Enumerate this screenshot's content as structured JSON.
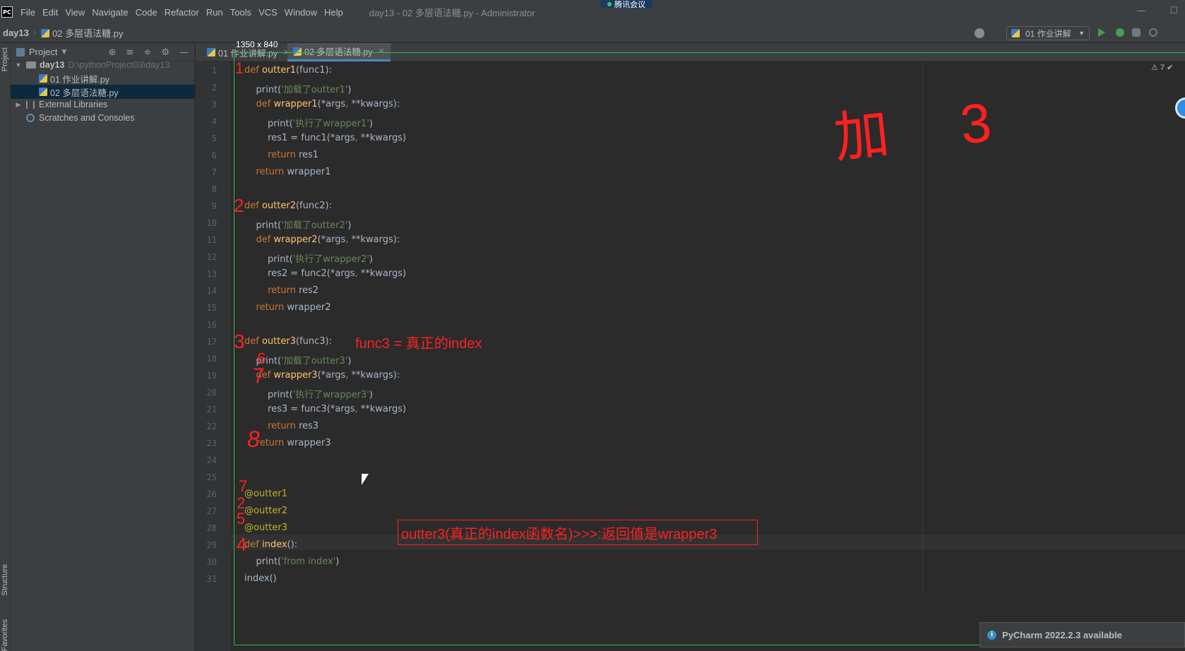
{
  "titlebar": {
    "menu": [
      "File",
      "Edit",
      "View",
      "Navigate",
      "Code",
      "Refactor",
      "Run",
      "Tools",
      "VCS",
      "Window",
      "Help"
    ],
    "window_title": "day13 - 02 多层语法糖.py - Administrator",
    "meeting_label": "腾讯会议"
  },
  "navbar": {
    "project": "day13",
    "file": "02 多层语法糖.py",
    "run_config": "01 作业讲解"
  },
  "left_strip": {
    "project_tab": "Project",
    "structure_tab": "Structure",
    "favorites_tab": "Favorites"
  },
  "project_panel": {
    "title": "Project",
    "tree": {
      "root_label": "day13",
      "root_path": "D:\\pythonProject03\\day13",
      "file1": "01 作业讲解.py",
      "file2": "02 多层语法糖.py",
      "external_libraries": "External Libraries",
      "scratches": "Scratches and Consoles"
    }
  },
  "editor": {
    "tabs": [
      "01 作业讲解.py",
      "02 多层语法糖.py"
    ],
    "warning_count": "7",
    "capture_size": "1350 x 840"
  },
  "code_lines": [
    "def outter1(func1):",
    "    print('加载了outter1')",
    "    def wrapper1(*args, **kwargs):",
    "        print('执行了wrapper1')",
    "        res1 = func1(*args, **kwargs)",
    "        return res1",
    "    return wrapper1",
    "",
    "def outter2(func2):",
    "    print('加载了outter2')",
    "    def wrapper2(*args, **kwargs):",
    "        print('执行了wrapper2')",
    "        res2 = func2(*args, **kwargs)",
    "        return res2",
    "    return wrapper2",
    "",
    "def outter3(func3):",
    "    print('加载了outter3')",
    "    def wrapper3(*args, **kwargs):",
    "        print('执行了wrapper3')",
    "        res3 = func3(*args, **kwargs)",
    "        return res3",
    "    return wrapper3",
    "",
    "",
    "@outter1",
    "@outter2",
    "@outter3",
    "def index():",
    "    print('from index')",
    "index()"
  ],
  "annotations": {
    "handwritten_top": "加 3",
    "func3_note": "func3 = 真正的index",
    "boxed_note": "outter3(真正的index函数名)>>>:返回值是wrapper3",
    "margin_numbers": [
      "1",
      "2",
      "3",
      "6",
      "7",
      "8",
      "7",
      "2",
      "5",
      "4"
    ]
  },
  "notification": {
    "message": "PyCharm 2022.2.3 available"
  }
}
